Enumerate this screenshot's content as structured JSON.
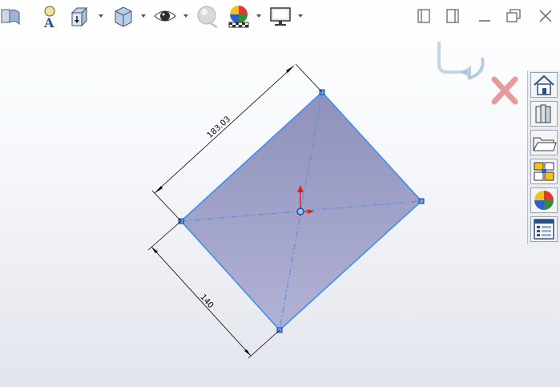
{
  "sketch": {
    "dimension_long": "183.03",
    "dimension_short": "140"
  },
  "colors": {
    "sketch_fill": "#9c9dc5",
    "sketch_edge": "#3d8ff0",
    "dimension_line": "#000000",
    "origin_arrow": "#e02020"
  },
  "toolbar": {
    "icons": [
      "section-view-icon",
      "annotation-icon",
      "view-orientation-icon",
      "display-style-icon",
      "hide-show-icon",
      "edit-appearance-icon",
      "apply-scene-icon",
      "view-settings-icon"
    ]
  },
  "confirm_corner": {
    "icons": [
      "exit-sketch-icon",
      "cancel-sketch-icon"
    ]
  },
  "task_pane": {
    "icons": [
      "home-icon",
      "design-library-icon",
      "file-explorer-icon",
      "view-palette-icon",
      "appearances-icon",
      "custom-properties-icon"
    ]
  }
}
